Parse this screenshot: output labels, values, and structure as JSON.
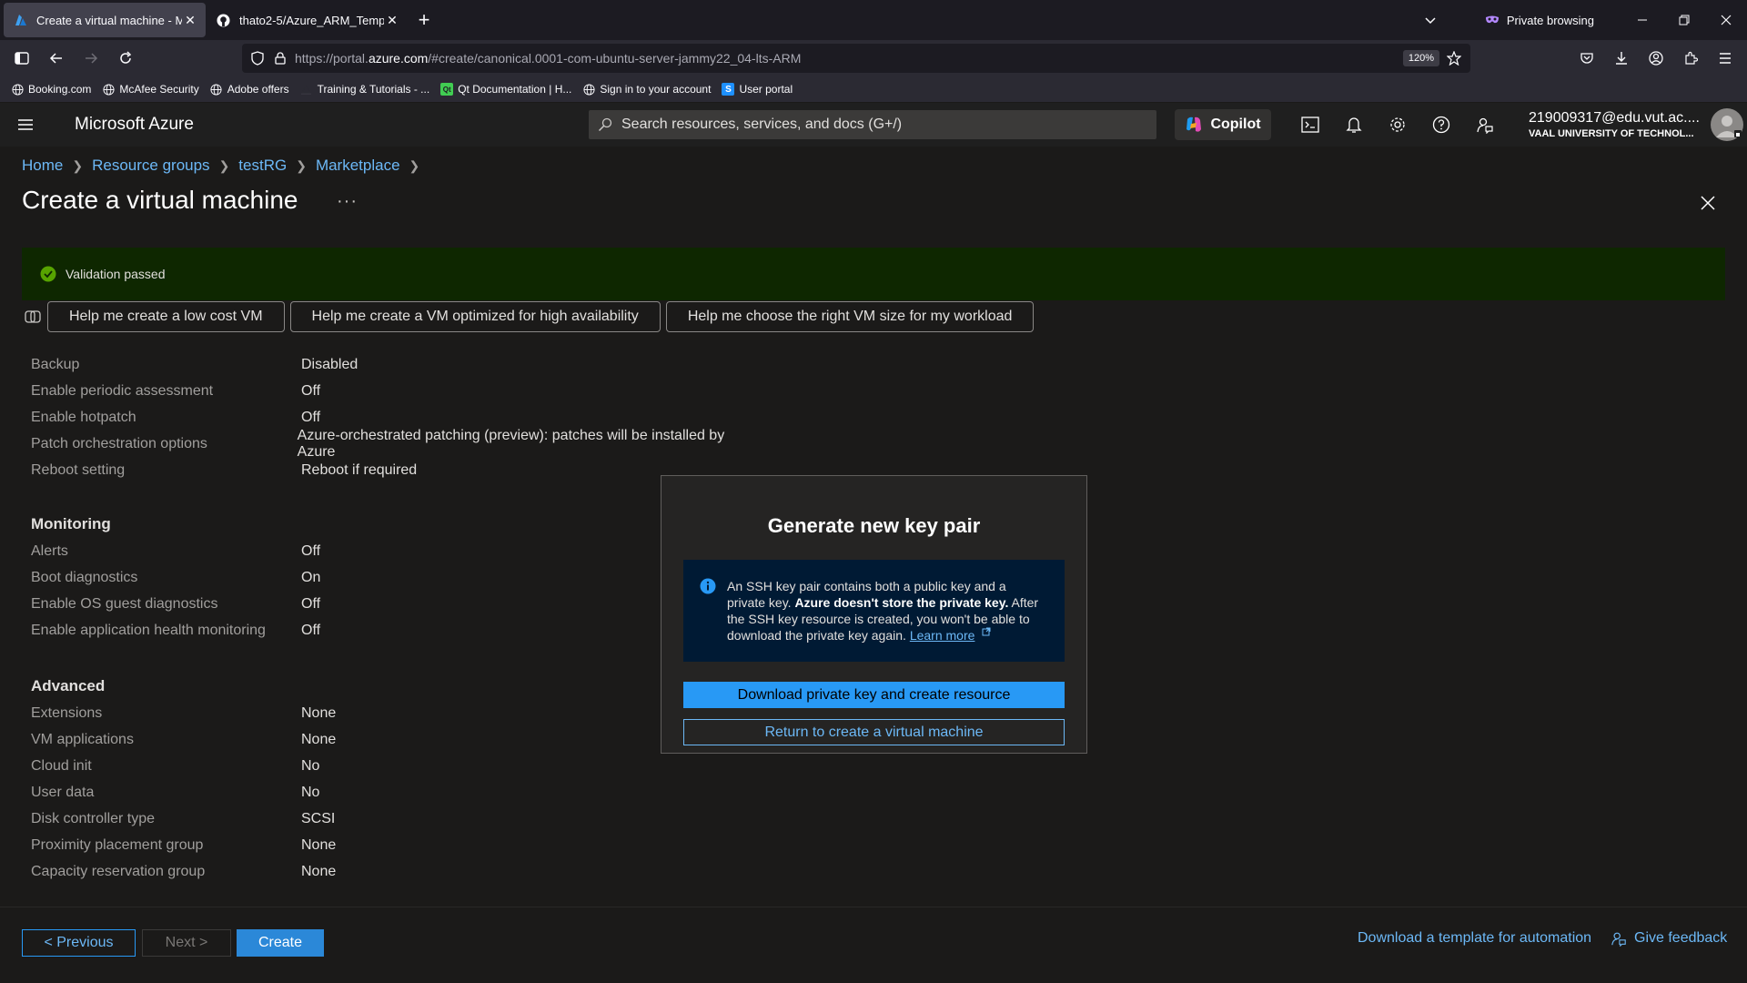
{
  "browser": {
    "tabs": [
      {
        "title": "Create a virtual machine - Micro",
        "icon": "azure-icon"
      },
      {
        "title": "thato2-5/Azure_ARM_Templates",
        "icon": "github-icon"
      }
    ],
    "private_label": "Private browsing",
    "url_prefix": "https://portal.",
    "url_domain": "azure.com",
    "url_rest": "/#create/canonical.0001-com-ubuntu-server-jammy22_04-lts-ARM",
    "zoom": "120%",
    "bookmarks": [
      {
        "label": "Booking.com",
        "icon": "globe-icon"
      },
      {
        "label": "McAfee Security",
        "icon": "globe-icon"
      },
      {
        "label": "Adobe offers",
        "icon": "globe-icon"
      },
      {
        "label": "Training & Tutorials - ...",
        "icon": "bookmark-icon"
      },
      {
        "label": "Qt Documentation | H...",
        "icon": "qt-icon"
      },
      {
        "label": "Sign in to your account",
        "icon": "globe-icon"
      },
      {
        "label": "User portal",
        "icon": "s-icon"
      }
    ]
  },
  "azure": {
    "brand": "Microsoft Azure",
    "search_placeholder": "Search resources, services, and docs (G+/)",
    "copilot_label": "Copilot",
    "account_name": "219009317@edu.vut.ac....",
    "account_org": "VAAL UNIVERSITY OF TECHNOL..."
  },
  "breadcrumb": [
    "Home",
    "Resource groups",
    "testRG",
    "Marketplace"
  ],
  "page_title": "Create a virtual machine",
  "title_more": "···",
  "validation_text": "Validation passed",
  "prompts": [
    "Help me create a low cost VM",
    "Help me create a VM optimized for high availability",
    "Help me choose the right VM size for my workload"
  ],
  "settings_top": [
    {
      "label": "Backup",
      "value": "Disabled"
    },
    {
      "label": "Enable periodic assessment",
      "value": "Off"
    },
    {
      "label": "Enable hotpatch",
      "value": "Off"
    },
    {
      "label": "Patch orchestration options",
      "value": "Azure-orchestrated patching (preview): patches will be installed by Azure"
    },
    {
      "label": "Reboot setting",
      "value": "Reboot if required"
    }
  ],
  "monitoring": {
    "heading": "Monitoring",
    "rows": [
      {
        "label": "Alerts",
        "value": "Off"
      },
      {
        "label": "Boot diagnostics",
        "value": "On"
      },
      {
        "label": "Enable OS guest diagnostics",
        "value": "Off"
      },
      {
        "label": "Enable application health monitoring",
        "value": "Off"
      }
    ]
  },
  "advanced": {
    "heading": "Advanced",
    "rows": [
      {
        "label": "Extensions",
        "value": "None"
      },
      {
        "label": "VM applications",
        "value": "None"
      },
      {
        "label": "Cloud init",
        "value": "No"
      },
      {
        "label": "User data",
        "value": "No"
      },
      {
        "label": "Disk controller type",
        "value": "SCSI"
      },
      {
        "label": "Proximity placement group",
        "value": "None"
      },
      {
        "label": "Capacity reservation group",
        "value": "None"
      }
    ]
  },
  "footer": {
    "previous": "< Previous",
    "next": "Next >",
    "create": "Create",
    "template_link": "Download a template for automation",
    "feedback": "Give feedback"
  },
  "dialog": {
    "title": "Generate new key pair",
    "info_part1": "An SSH key pair contains both a public key and a private key. ",
    "info_bold": "Azure doesn't store the private key.",
    "info_part2": " After the SSH key resource is created, you won't be able to download the private key again. ",
    "learn_more": "Learn more",
    "primary": "Download private key and create resource",
    "secondary": "Return to create a virtual machine"
  },
  "colors": {
    "accent": "#2899f5",
    "link": "#6cb8f6",
    "validation_bg": "#0e2700",
    "success": "#57a300"
  }
}
